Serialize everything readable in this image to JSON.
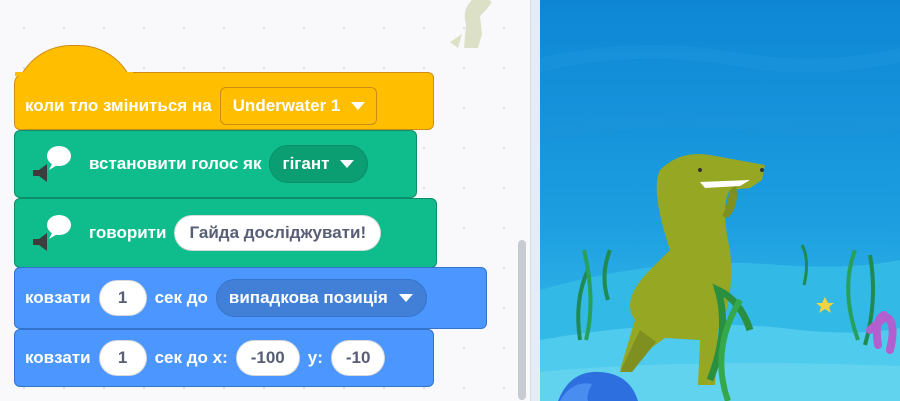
{
  "hat_block": {
    "label": "коли тло зміниться на",
    "backdrop_value": "Underwater 1"
  },
  "voice_block": {
    "label": "встановити голос як",
    "voice_value": "гігант"
  },
  "speak_block": {
    "label": "говорити",
    "text_value": "Гайда досліджувати!"
  },
  "glide_random_block": {
    "label_glide": "ковзати",
    "seconds": "1",
    "label_sec_to": "сек до",
    "target_value": "випадкова позиція"
  },
  "glide_xy_block": {
    "label_glide": "ковзати",
    "seconds": "1",
    "label_sec_to_x": "сек до x:",
    "x_value": "-100",
    "label_y": "y:",
    "y_value": "-10"
  },
  "colors": {
    "events": "#ffbf00",
    "text2speech": "#0fbd8c",
    "motion": "#4c97ff",
    "water": "#1a9fd9"
  },
  "icons": [
    "speaker-speech-icon",
    "dropdown-caret-icon",
    "dinosaur-sprite",
    "ghost-dinosaur-sprite"
  ]
}
